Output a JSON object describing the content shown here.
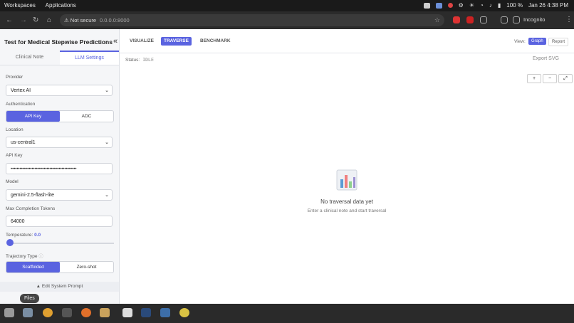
{
  "system_bar": {
    "workspaces": "Workspaces",
    "applications": "Applications",
    "battery": "100 %",
    "datetime": "Jan 26  4:38 PM"
  },
  "browser": {
    "security": "⚠ Not secure",
    "url": "0.0.0.0:8000",
    "incognito": "Incognito"
  },
  "sidebar": {
    "title": "Test for Medical Stepwise Predictions",
    "collapse": "«",
    "tabs": [
      "Clinical Note",
      "LLM Settings"
    ],
    "provider_label": "Provider",
    "provider_value": "Vertex AI",
    "auth_label": "Authentication",
    "auth_options": [
      "API Key",
      "ADC"
    ],
    "location_label": "Location",
    "location_value": "us-central1",
    "apikey_label": "API Key",
    "apikey_value": "••••••••••••••••••••••••••••••••••••••••••••",
    "model_label": "Model",
    "model_value": "gemini-2.5-flash-lite",
    "max_tokens_label": "Max Completion Tokens",
    "max_tokens_value": "64000",
    "temperature_label": "Temperature:",
    "temperature_value": "0.0",
    "temperature": 0.0,
    "trajectory_label": "Trajectory Type",
    "trajectory_options": [
      "Scaffolded",
      "Zero-shot"
    ],
    "system_prompt": "▲ Edit System Prompt"
  },
  "main": {
    "tabs": [
      "VISUALIZE",
      "TRAVERSE",
      "BENCHMARK"
    ],
    "view_label": "View:",
    "view_options": [
      "Graph",
      "Report"
    ],
    "status_label": "Status:",
    "status_value": "IDLE",
    "export": "Export SVG",
    "zoom": [
      "+",
      "−",
      "⤢"
    ],
    "empty_title": "No traversal data yet",
    "empty_sub": "Enter a clinical note and start traversal"
  },
  "taskbar": {
    "tooltip": "Files"
  },
  "colors": {
    "accent": "#5a63e0"
  }
}
